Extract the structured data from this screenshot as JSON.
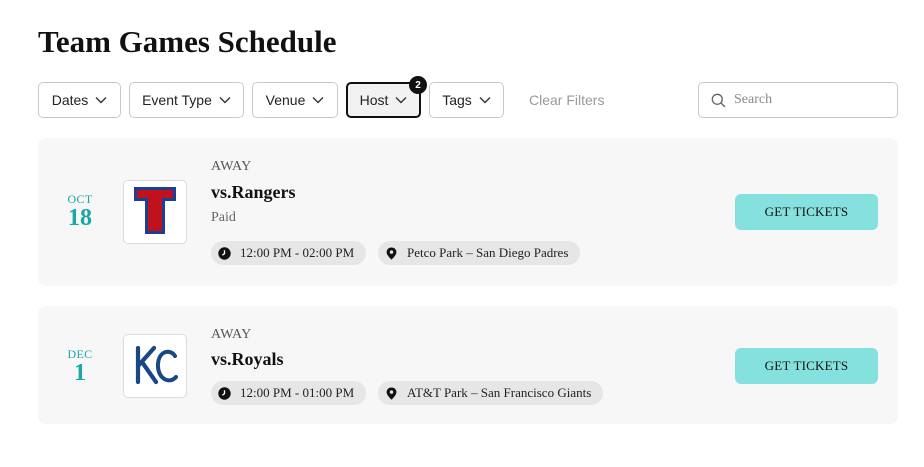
{
  "page": {
    "title": "Team Games Schedule"
  },
  "filters": {
    "dates": "Dates",
    "event_type": "Event Type",
    "venue": "Venue",
    "host": "Host",
    "host_badge": "2",
    "tags": "Tags",
    "clear": "Clear Filters"
  },
  "search": {
    "placeholder": "Search",
    "value": ""
  },
  "events": [
    {
      "month": "OCT",
      "day": "18",
      "kind": "AWAY",
      "opponent": "vs.Rangers",
      "price": "Paid",
      "time": "12:00 PM - 02:00 PM",
      "location": "Petco Park – San Diego Padres",
      "logo": "rangers-logo",
      "cta": "GET TICKETS"
    },
    {
      "month": "DEC",
      "day": "1",
      "kind": "AWAY",
      "opponent": "vs.Royals",
      "time": "12:00 PM - 01:00 PM",
      "location": "AT&T Park – San Francisco Giants",
      "logo": "royals-logo",
      "cta": "GET TICKETS"
    }
  ],
  "colors": {
    "accent_teal": "#1aa7a7",
    "button_teal": "#84e1de",
    "card_bg": "#f7f7f7",
    "pill_bg": "#e6e6e6",
    "rangers_red": "#c0111f",
    "rangers_blue": "#1c3f94",
    "royals_blue": "#174885"
  }
}
